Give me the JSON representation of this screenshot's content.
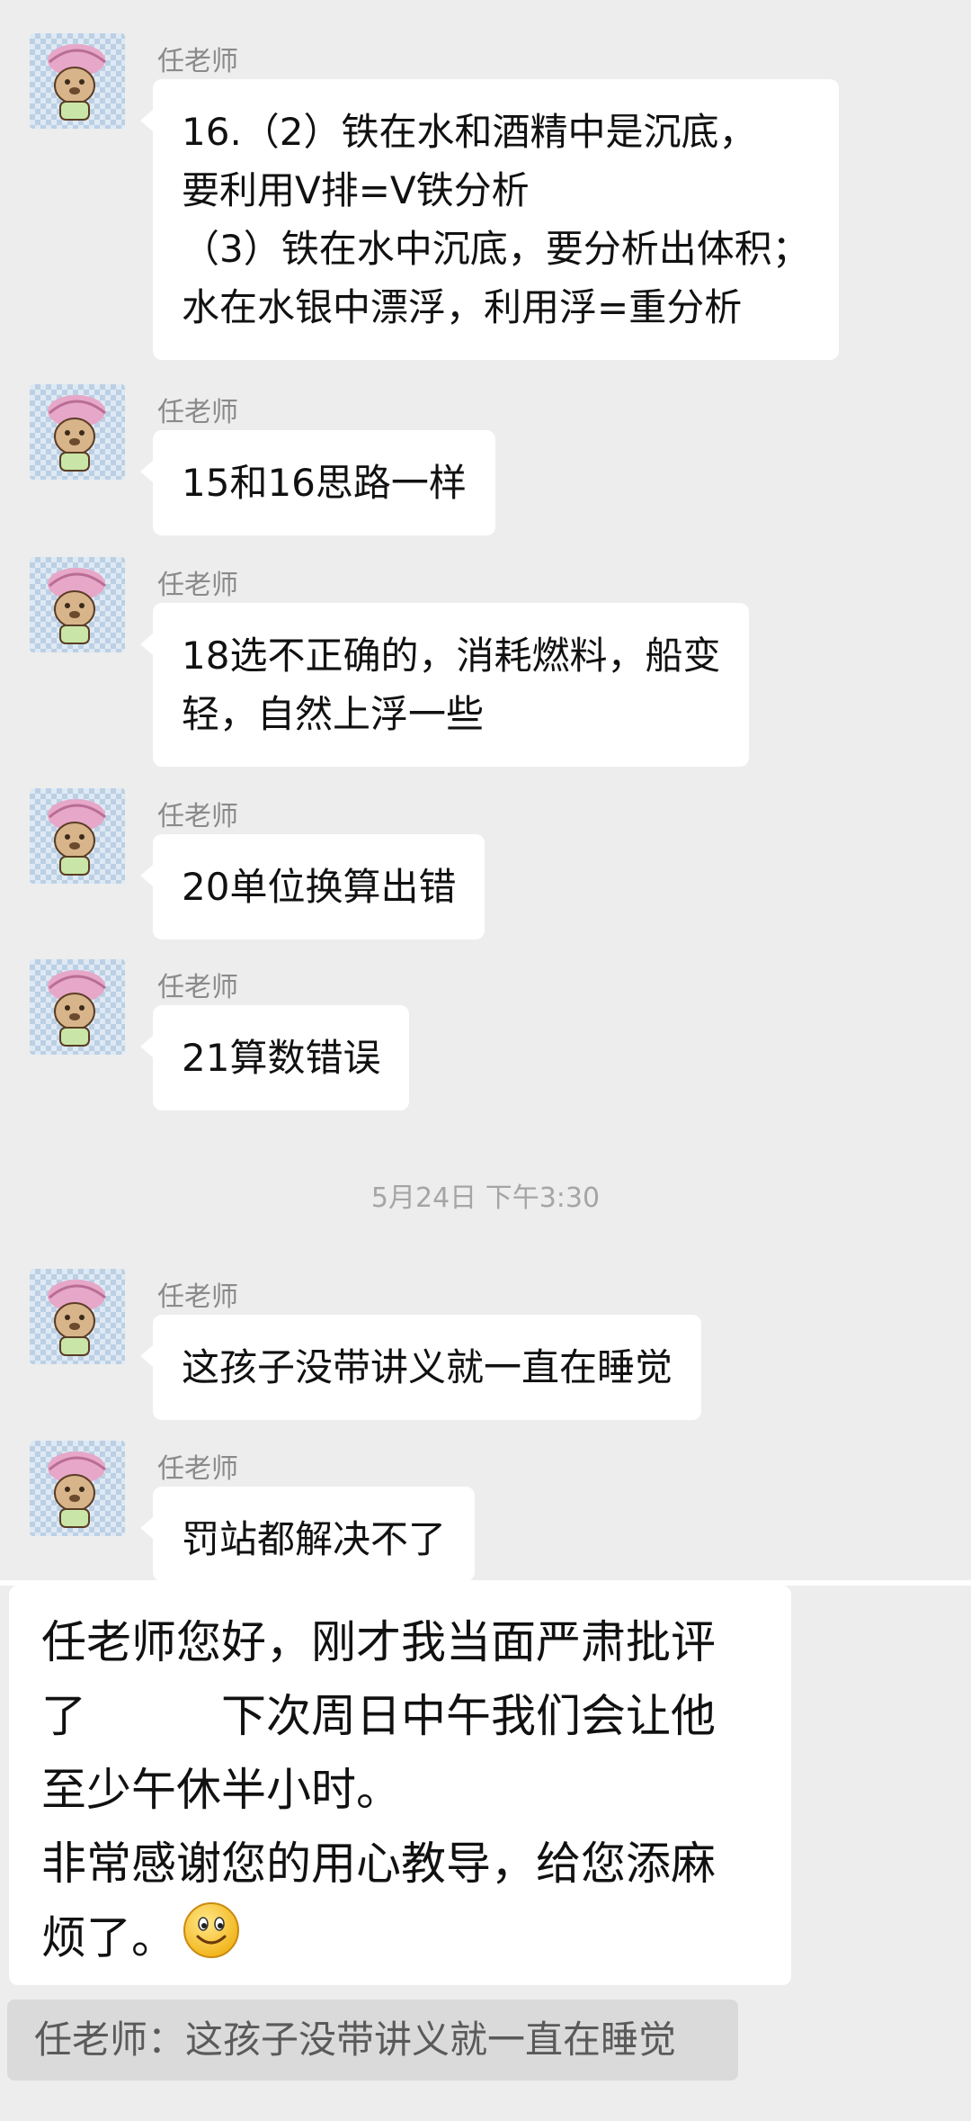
{
  "messages": [
    {
      "sender": "任老师",
      "lines": [
        "16.（2）铁在水和酒精中是沉底，",
        "要利用V排=V铁分析",
        "（3）铁在水中沉底，要分析出体积；",
        "水在水银中漂浮，利用浮=重分析"
      ]
    },
    {
      "sender": "任老师",
      "lines": [
        "15和16思路一样"
      ]
    },
    {
      "sender": "任老师",
      "lines": [
        "18选不正确的，消耗燃料，船变",
        "轻，自然上浮一些"
      ]
    },
    {
      "sender": "任老师",
      "lines": [
        "20单位换算出错"
      ]
    },
    {
      "sender": "任老师",
      "lines": [
        "21算数错误"
      ]
    },
    {
      "sender": "任老师",
      "lines": [
        "这孩子没带讲义就一直在睡觉"
      ]
    },
    {
      "sender": "任老师",
      "lines": [
        "罚站都解决不了"
      ]
    }
  ],
  "timestamp": "5月24日 下午3:30",
  "reply": {
    "line1": "任老师您好，刚才我当面严肃批评",
    "line2_start": "了",
    "line2_end": "下次周日中午我们会让他",
    "line3": "至少午休半小时。",
    "line4": "非常感谢您的用心教导，给您添麻",
    "line5": "烦了。",
    "emoji": "smile-emoji"
  },
  "quote": "任老师：这孩子没带讲义就一直在睡觉",
  "colors": {
    "background": "#ededed",
    "bubble": "#ffffff",
    "meta_text": "#8a8a8a",
    "quote_bg": "#dadada"
  }
}
